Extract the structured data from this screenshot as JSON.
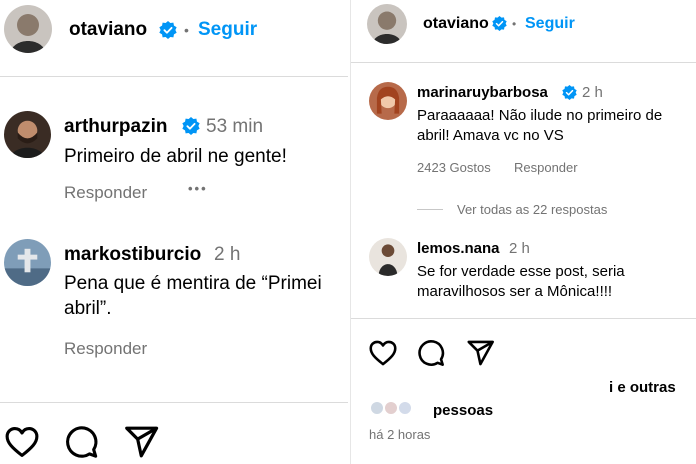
{
  "left": {
    "header": {
      "username": "otaviano",
      "separator": "•",
      "follow_label": "Seguir"
    },
    "comments": [
      {
        "username": "arthurpazin",
        "time": "53 min",
        "text": "Primeiro de abril ne gente!",
        "reply_label": "Responder",
        "more": "•••"
      },
      {
        "username": "markostiburcio",
        "time": "2 h",
        "text": "Pena que é mentira de “Primei abril”.",
        "reply_label": "Responder"
      }
    ],
    "actions": [
      "heart-icon",
      "comment-icon",
      "share-icon"
    ]
  },
  "right": {
    "header": {
      "username": "otaviano",
      "separator": "•",
      "follow_label": "Seguir"
    },
    "comments": [
      {
        "username": "marinaruybarbosa",
        "time": "2 h",
        "text": "Paraaaaaa! Não ilude no primeiro de abril! Amava vc no VS",
        "likes": "2423 Gostos",
        "reply_label": "Responder"
      },
      {
        "username": "lemos.nana",
        "time": "2 h",
        "text": "Se for verdade esse post, seria maravilhosos ser a Mônica!!!!"
      }
    ],
    "view_replies": "Ver todas as 22 respostas",
    "liked_by_suffix": "i e outras",
    "liked_by_people": "pessoas",
    "posted_time": "há 2 horas",
    "actions": [
      "heart-icon",
      "comment-icon",
      "share-icon"
    ]
  },
  "colors": {
    "link_blue": "#0095f6",
    "verified_blue": "#0095f6",
    "muted_gray": "#737373",
    "divider": "#dbdbdb"
  }
}
